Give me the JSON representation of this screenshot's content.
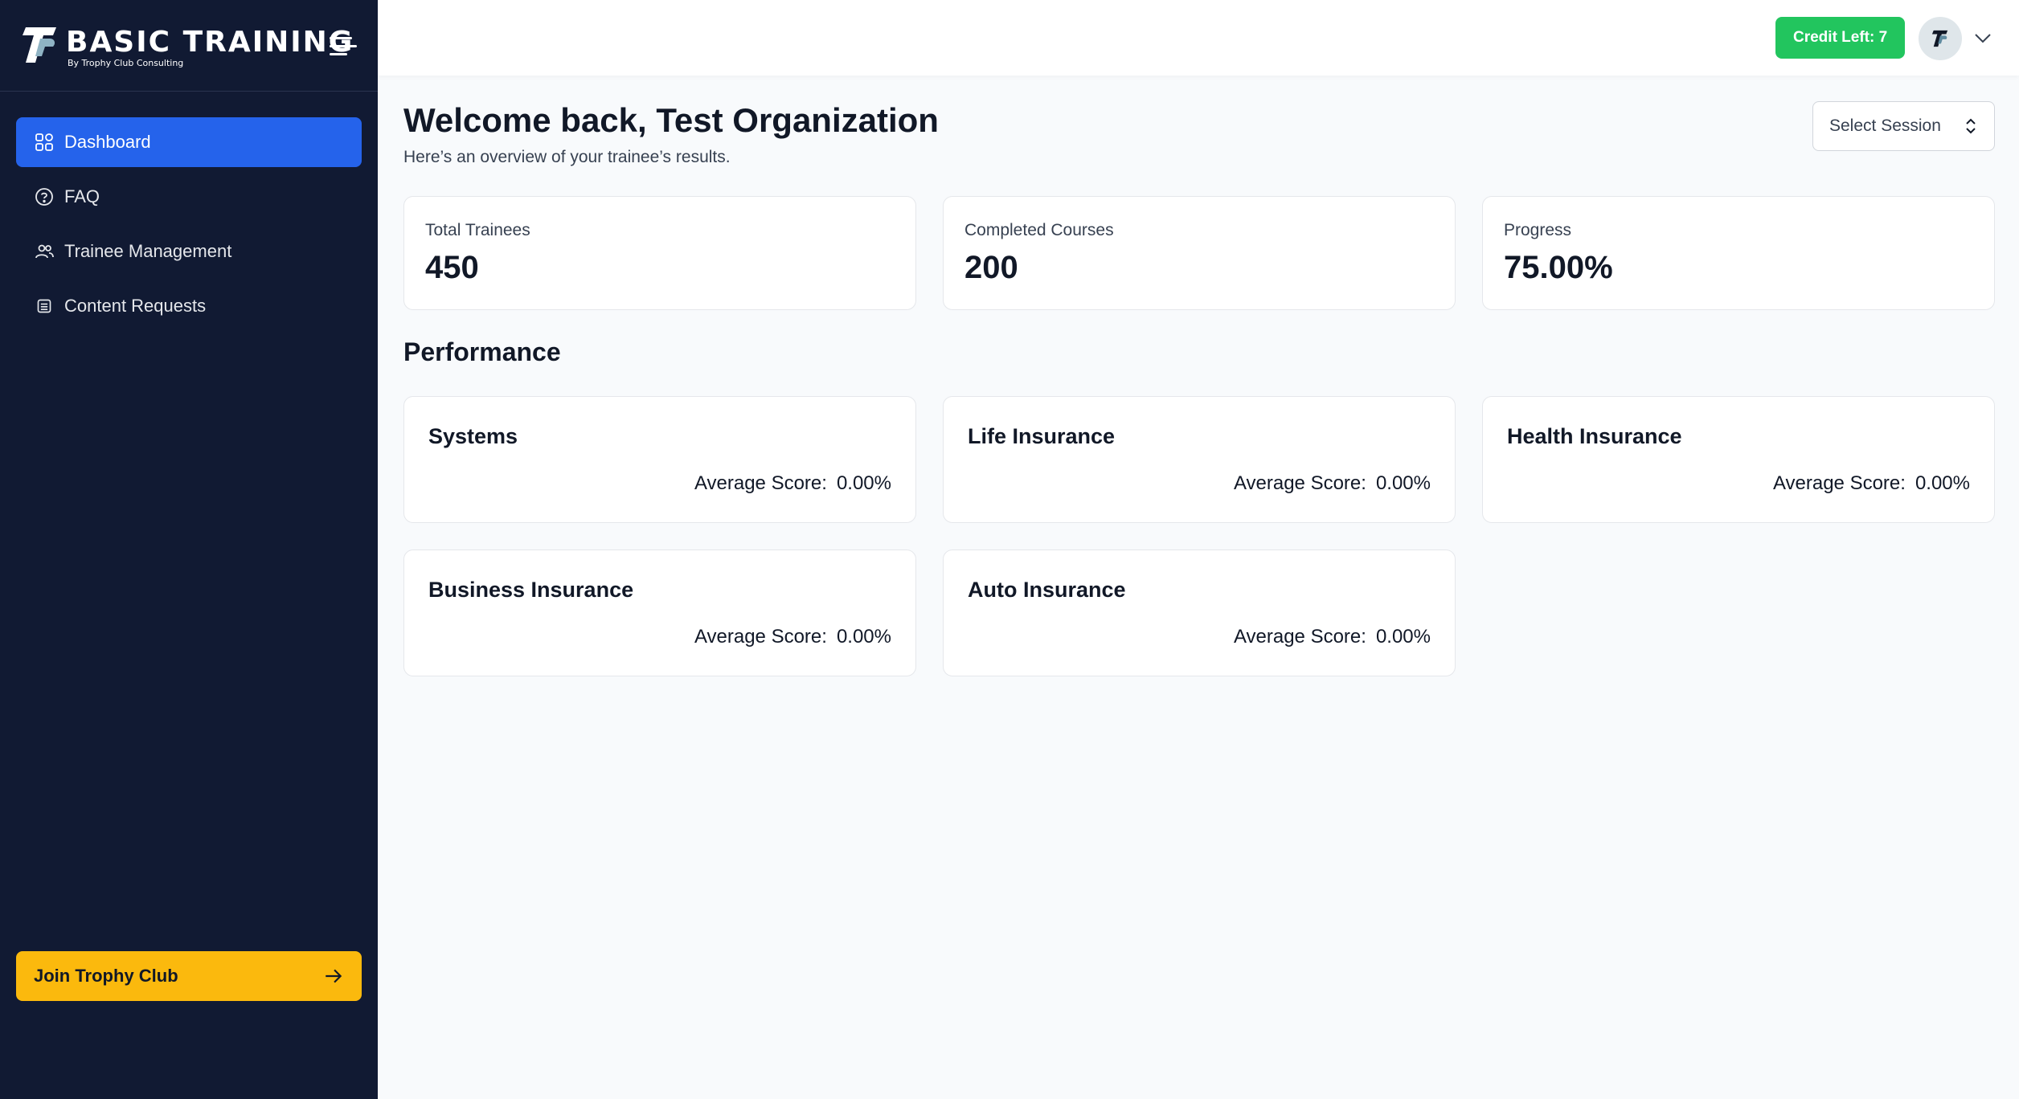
{
  "brand": {
    "title": "BASIC TRAINING",
    "subtitle": "By Trophy Club Consulting"
  },
  "sidebar": {
    "items": [
      {
        "label": "Dashboard",
        "icon": "grid-icon",
        "active": true
      },
      {
        "label": "FAQ",
        "icon": "help-circle-icon",
        "active": false
      },
      {
        "label": "Trainee Management",
        "icon": "users-icon",
        "active": false
      },
      {
        "label": "Content Requests",
        "icon": "list-icon",
        "active": false
      }
    ],
    "join_button": {
      "label": "Join Trophy Club",
      "icon": "arrow-right-icon"
    }
  },
  "topbar": {
    "credit_label": "Credit Left: 7"
  },
  "header": {
    "welcome": "Welcome back, Test Organization",
    "subtitle": "Here’s an overview of your trainee’s results.",
    "session_select": "Select Session"
  },
  "stats": [
    {
      "label": "Total Trainees",
      "value": "450"
    },
    {
      "label": "Completed Courses",
      "value": "200"
    },
    {
      "label": "Progress",
      "value": "75.00%"
    }
  ],
  "performance": {
    "title": "Performance",
    "score_label": "Average Score:",
    "cards": [
      {
        "title": "Systems",
        "score": "0.00%"
      },
      {
        "title": "Life Insurance",
        "score": "0.00%"
      },
      {
        "title": "Health Insurance",
        "score": "0.00%"
      },
      {
        "title": "Business Insurance",
        "score": "0.00%"
      },
      {
        "title": "Auto Insurance",
        "score": "0.00%"
      }
    ]
  },
  "colors": {
    "sidebar_bg": "#111a33",
    "accent": "#2563eb",
    "credit": "#22c55e",
    "join": "#fbb90d"
  }
}
